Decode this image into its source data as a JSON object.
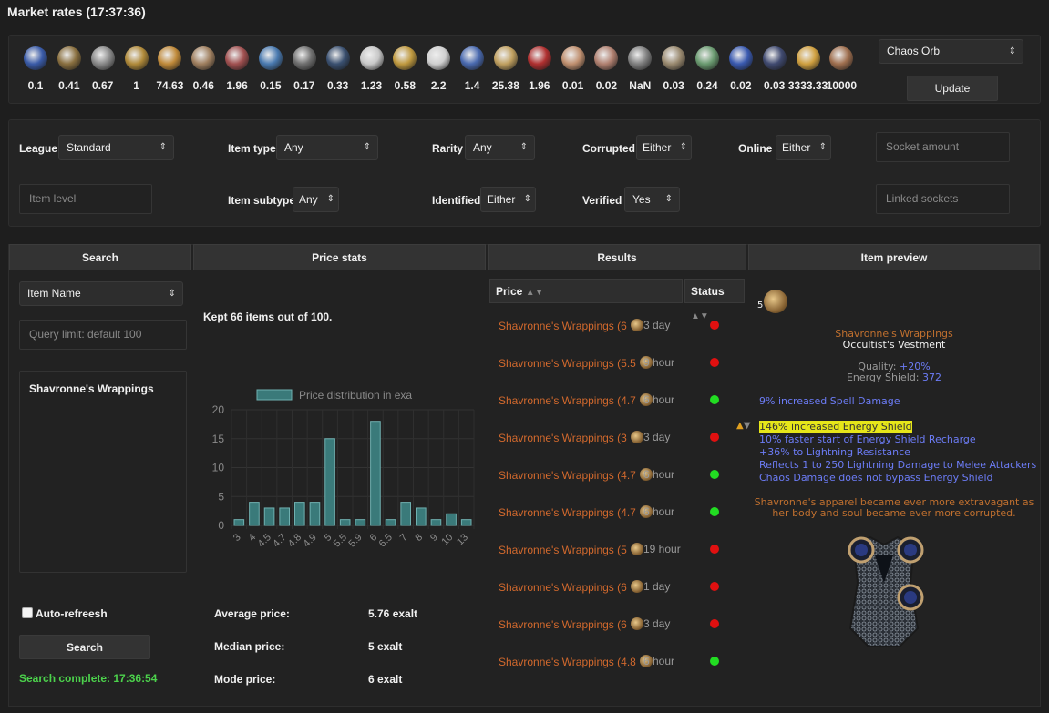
{
  "title": "Market rates (17:37:36)",
  "rates": [
    {
      "icon": "blue-crystal-icon",
      "value": "0.1",
      "color": "#3a5ba8"
    },
    {
      "icon": "spiral-horn-icon",
      "value": "0.41",
      "color": "#8a7040"
    },
    {
      "icon": "chain-links-icon",
      "value": "0.67",
      "color": "#8a8a8a"
    },
    {
      "icon": "jeweled-orb-icon",
      "value": "1",
      "color": "#b08a3a"
    },
    {
      "icon": "exalted-orb-icon",
      "value": "74.63",
      "color": "#c08a3a"
    },
    {
      "icon": "needle-icon",
      "value": "0.46",
      "color": "#a08060"
    },
    {
      "icon": "prism-icon",
      "value": "1.96",
      "color": "#a05050"
    },
    {
      "icon": "rainbow-shard-icon",
      "value": "0.15",
      "color": "#4a7ab0"
    },
    {
      "icon": "ring-icon",
      "value": "0.17",
      "color": "#707070"
    },
    {
      "icon": "blue-claw-icon",
      "value": "0.33",
      "color": "#3a5070"
    },
    {
      "icon": "silver-orb-icon",
      "value": "1.23",
      "color": "#c8c8c8"
    },
    {
      "icon": "gold-coin-icon",
      "value": "0.58",
      "color": "#c09a40"
    },
    {
      "icon": "silver-skull-icon",
      "value": "2.2",
      "color": "#d0d0d0"
    },
    {
      "icon": "blue-mask-icon",
      "value": "1.4",
      "color": "#4a6ab0"
    },
    {
      "icon": "gold-skull-icon",
      "value": "25.38",
      "color": "#c0a060"
    },
    {
      "icon": "red-orb-icon",
      "value": "1.96",
      "color": "#b03030"
    },
    {
      "icon": "bone-icon",
      "value": "0.01",
      "color": "#c09070"
    },
    {
      "icon": "quill-icon",
      "value": "0.02",
      "color": "#b08070"
    },
    {
      "icon": "grey-stone-icon",
      "value": "NaN",
      "color": "#808080"
    },
    {
      "icon": "shard-icon",
      "value": "0.03",
      "color": "#9a8a70"
    },
    {
      "icon": "green-orb-icon",
      "value": "0.24",
      "color": "#6a9a70"
    },
    {
      "icon": "blue-splash-icon",
      "value": "0.02",
      "color": "#3a5ab0"
    },
    {
      "icon": "dark-orb-icon",
      "value": "0.03",
      "color": "#404a70"
    },
    {
      "icon": "gold-ring-icon",
      "value": "3333.33",
      "color": "#d0a040"
    },
    {
      "icon": "mirror-icon",
      "value": "10000",
      "color": "#a07050"
    }
  ],
  "currency_select": "Chaos Orb",
  "update_label": "Update",
  "filters": {
    "league_label": "League",
    "league_value": "Standard",
    "item_type_label": "Item type",
    "item_type_value": "Any",
    "rarity_label": "Rarity",
    "rarity_value": "Any",
    "corrupted_label": "Corrupted",
    "corrupted_value": "Either",
    "online_label": "Online",
    "online_value": "Either",
    "socket_amount_placeholder": "Socket amount",
    "item_level_placeholder": "Item level",
    "item_subtype_label": "Item subtype",
    "item_subtype_value": "Any",
    "identified_label": "Identified",
    "identified_value": "Either",
    "verified_label": "Verified",
    "verified_value": "Yes",
    "linked_sockets_placeholder": "Linked sockets"
  },
  "headers": {
    "search": "Search",
    "price_stats": "Price stats",
    "results": "Results",
    "item_preview": "Item preview"
  },
  "search": {
    "field_select": "Item Name",
    "query_placeholder": "Query limit: default 100",
    "query_text": "Shavronne's Wrappings",
    "auto_refresh_label": "Auto-refreesh",
    "search_button": "Search",
    "status": "Search complete: 17:36:54",
    "status_color": "#4cd24c"
  },
  "stats": {
    "kept": "Kept 66 items out of 100.",
    "avg_label": "Average price:",
    "avg_value": "5.76 exalt",
    "median_label": "Median price:",
    "median_value": "5 exalt",
    "mode_label": "Mode price:",
    "mode_value": "6 exalt"
  },
  "chart_data": {
    "type": "bar",
    "legend": "Price distribution in exa",
    "categories": [
      "3",
      "4",
      "4.5",
      "4.7",
      "4.8",
      "4.9",
      "5",
      "5.5",
      "5.9",
      "6",
      "6.5",
      "7",
      "8",
      "9",
      "10",
      "13"
    ],
    "values": [
      1,
      4,
      3,
      3,
      4,
      4,
      15,
      1,
      1,
      18,
      1,
      4,
      3,
      1,
      2,
      1
    ],
    "ylim": [
      0,
      20
    ],
    "yticks": [
      "0",
      "5",
      "10",
      "15",
      "20"
    ],
    "bar_color": "#3a7a7a"
  },
  "results": {
    "price_header": "Price",
    "status_header": "Status",
    "rows": [
      {
        "name": "Shavronne's Wrappings (6",
        "age": "3 day",
        "online": false
      },
      {
        "name": "Shavronne's Wrappings (5.5",
        "age": "9 hour",
        "online": false
      },
      {
        "name": "Shavronne's Wrappings (4.7",
        "age": "6 hour",
        "online": true
      },
      {
        "name": "Shavronne's Wrappings (3",
        "age": "3 day",
        "online": false
      },
      {
        "name": "Shavronne's Wrappings (4.7",
        "age": "6 hour",
        "online": true
      },
      {
        "name": "Shavronne's Wrappings (4.7",
        "age": "6 hour",
        "online": true
      },
      {
        "name": "Shavronne's Wrappings (5",
        "age": "19 hour",
        "online": false
      },
      {
        "name": "Shavronne's Wrappings (6",
        "age": "1 day",
        "online": false
      },
      {
        "name": "Shavronne's Wrappings (6",
        "age": "3 day",
        "online": false
      },
      {
        "name": "Shavronne's Wrappings (4.8",
        "age": "6 hour",
        "online": true
      }
    ],
    "online_color": "#22dd22",
    "offline_color": "#e01010"
  },
  "preview": {
    "price_count": "5",
    "name": "Shavronne's Wrappings",
    "base": "Occultist's Vestment",
    "quality_label": "Quality: ",
    "quality_value": "+20%",
    "es_label": "Energy Shield: ",
    "es_value": "372",
    "implicit": "9% increased Spell Damage",
    "mods": [
      "146% increased Energy Shield",
      "10% faster start of Energy Shield Recharge",
      "+36% to Lightning Resistance",
      "Reflects 1 to 250 Lightning Damage to Melee Attackers",
      "Chaos Damage does not bypass Energy Shield"
    ],
    "flavour": [
      "Shavronne's apparel became ever more extravagant as",
      "her body and soul became ever more corrupted."
    ]
  }
}
